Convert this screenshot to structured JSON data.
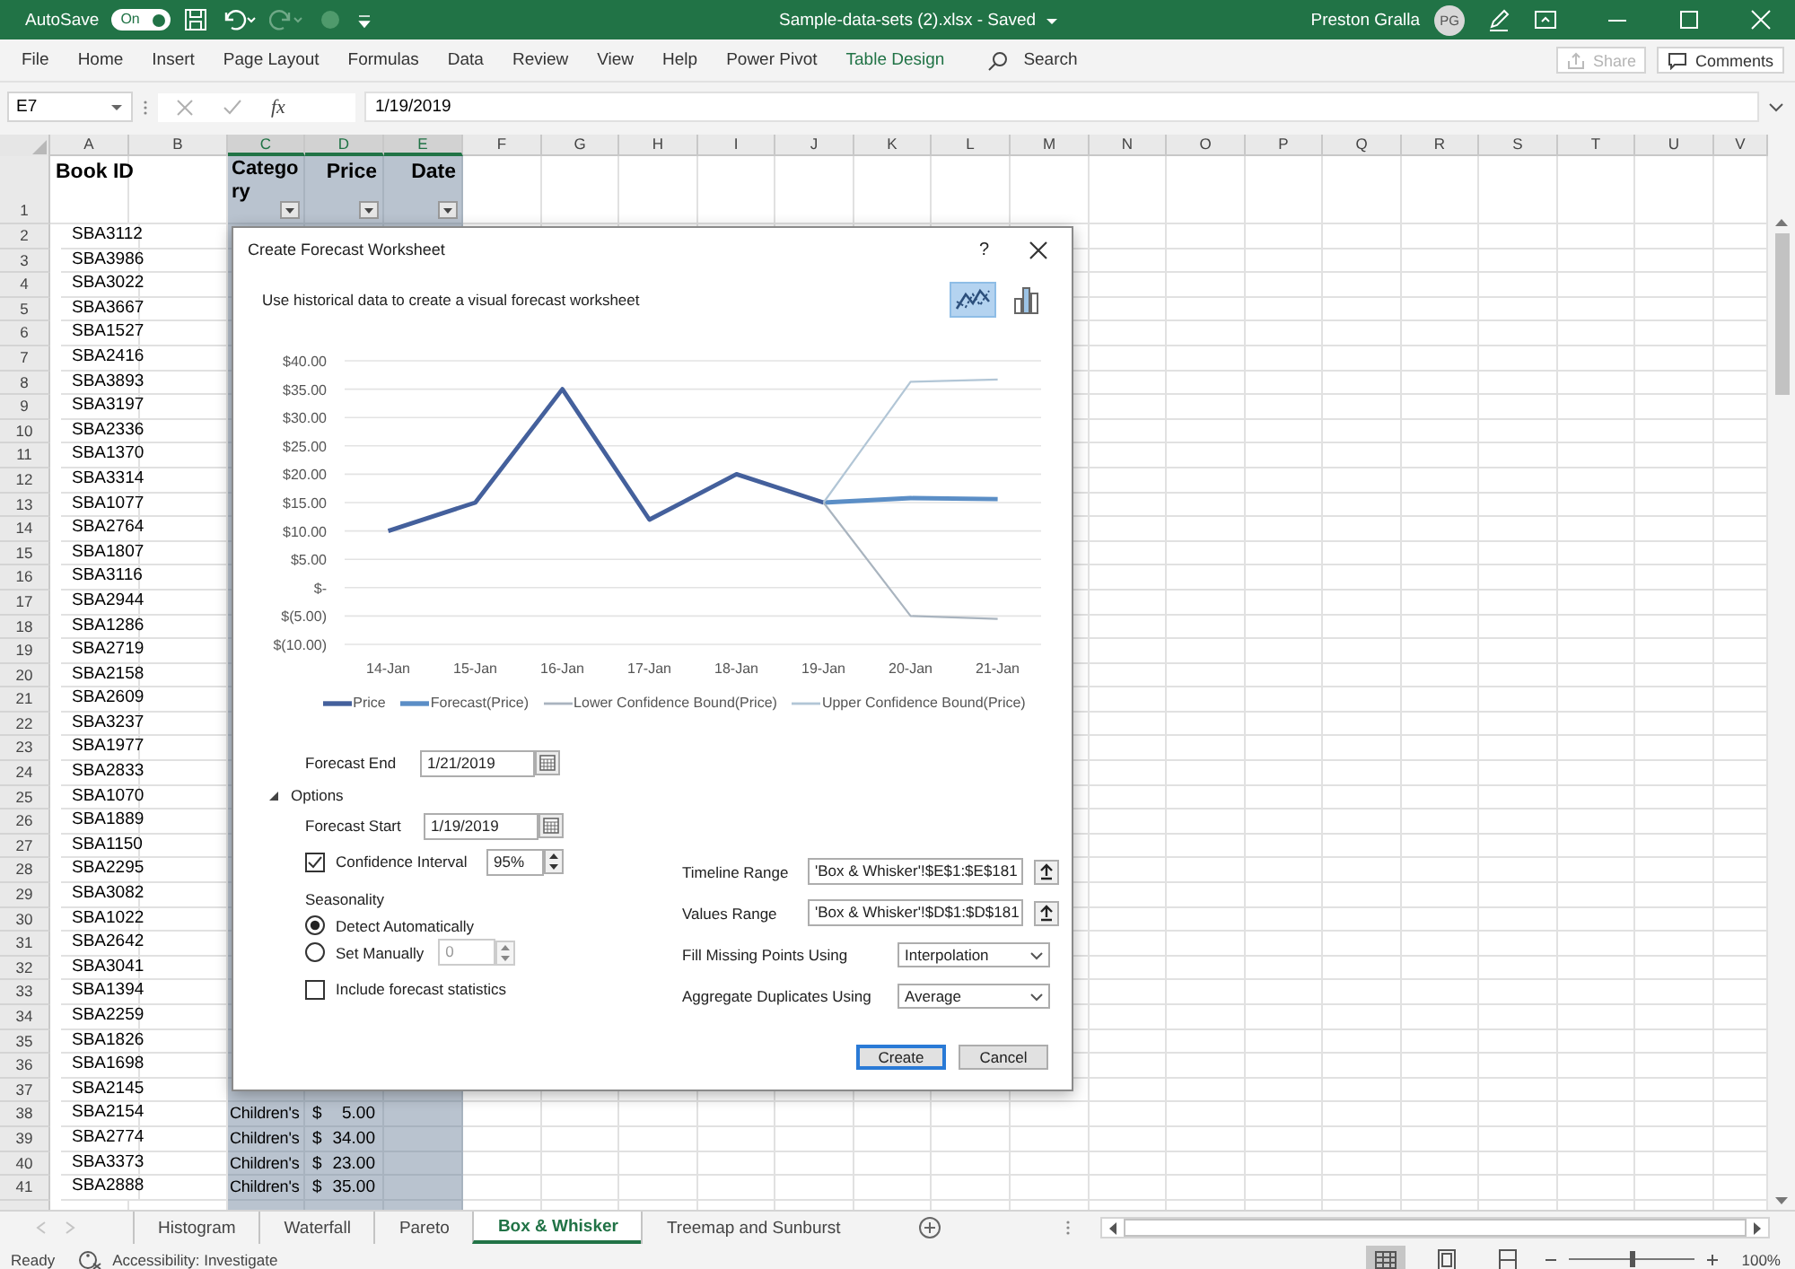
{
  "title_bar": {
    "autosave_label": "AutoSave",
    "autosave": {
      "label": "On",
      "on": true
    },
    "file_title": "Sample-data-sets (2).xlsx - Saved",
    "user_name": "Preston Gralla",
    "user_initials": "PG"
  },
  "ribbon": {
    "tabs": [
      {
        "label": "File",
        "contextual": false
      },
      {
        "label": "Home",
        "contextual": false
      },
      {
        "label": "Insert",
        "contextual": false
      },
      {
        "label": "Page Layout",
        "contextual": false
      },
      {
        "label": "Formulas",
        "contextual": false
      },
      {
        "label": "Data",
        "contextual": false
      },
      {
        "label": "Review",
        "contextual": false
      },
      {
        "label": "View",
        "contextual": false
      },
      {
        "label": "Help",
        "contextual": false
      },
      {
        "label": "Power Pivot",
        "contextual": false
      },
      {
        "label": "Table Design",
        "contextual": true
      }
    ],
    "search": {
      "placeholder": "Search"
    },
    "share": {
      "label": "Share",
      "disabled": true
    },
    "comments": {
      "label": "Comments",
      "disabled": false
    }
  },
  "formula_bar": {
    "name_box": "E7",
    "fx": "fx",
    "formula": "1/19/2019"
  },
  "sheet": {
    "columns": [
      {
        "letter": "A",
        "selected": false
      },
      {
        "letter": "B",
        "selected": false
      },
      {
        "letter": "C",
        "selected": true
      },
      {
        "letter": "D",
        "selected": true
      },
      {
        "letter": "E",
        "selected": true
      },
      {
        "letter": "F",
        "selected": false
      },
      {
        "letter": "G",
        "selected": false
      },
      {
        "letter": "H",
        "selected": false
      },
      {
        "letter": "I",
        "selected": false
      },
      {
        "letter": "J",
        "selected": false
      },
      {
        "letter": "K",
        "selected": false
      },
      {
        "letter": "L",
        "selected": false
      },
      {
        "letter": "M",
        "selected": false
      },
      {
        "letter": "N",
        "selected": false
      },
      {
        "letter": "O",
        "selected": false
      },
      {
        "letter": "P",
        "selected": false
      },
      {
        "letter": "Q",
        "selected": false
      },
      {
        "letter": "R",
        "selected": false
      },
      {
        "letter": "S",
        "selected": false
      },
      {
        "letter": "T",
        "selected": false
      },
      {
        "letter": "U",
        "selected": false
      },
      {
        "letter": "V",
        "selected": false
      }
    ],
    "header_row": {
      "number": "1",
      "book_id": "Book ID",
      "category": "Category",
      "price": "Price",
      "date": "Date",
      "filter_buttons": true
    },
    "rows": [
      {
        "number": "2",
        "book_id": "SBA3112"
      },
      {
        "number": "3",
        "book_id": "SBA3986"
      },
      {
        "number": "4",
        "book_id": "SBA3022"
      },
      {
        "number": "5",
        "book_id": "SBA3667"
      },
      {
        "number": "6",
        "book_id": "SBA1527"
      },
      {
        "number": "7",
        "book_id": "SBA2416"
      },
      {
        "number": "8",
        "book_id": "SBA3893"
      },
      {
        "number": "9",
        "book_id": "SBA3197"
      },
      {
        "number": "10",
        "book_id": "SBA2336"
      },
      {
        "number": "11",
        "book_id": "SBA1370"
      },
      {
        "number": "12",
        "book_id": "SBA3314"
      },
      {
        "number": "13",
        "book_id": "SBA1077"
      },
      {
        "number": "14",
        "book_id": "SBA2764"
      },
      {
        "number": "15",
        "book_id": "SBA1807"
      },
      {
        "number": "16",
        "book_id": "SBA3116"
      },
      {
        "number": "17",
        "book_id": "SBA2944"
      },
      {
        "number": "18",
        "book_id": "SBA1286"
      },
      {
        "number": "19",
        "book_id": "SBA2719"
      },
      {
        "number": "20",
        "book_id": "SBA2158"
      },
      {
        "number": "21",
        "book_id": "SBA2609"
      },
      {
        "number": "22",
        "book_id": "SBA3237"
      },
      {
        "number": "23",
        "book_id": "SBA1977"
      },
      {
        "number": "24",
        "book_id": "SBA2833"
      },
      {
        "number": "25",
        "book_id": "SBA1070"
      },
      {
        "number": "26",
        "book_id": "SBA1889"
      },
      {
        "number": "27",
        "book_id": "SBA1150"
      },
      {
        "number": "28",
        "book_id": "SBA2295"
      },
      {
        "number": "29",
        "book_id": "SBA3082"
      },
      {
        "number": "30",
        "book_id": "SBA1022"
      },
      {
        "number": "31",
        "book_id": "SBA2642"
      },
      {
        "number": "32",
        "book_id": "SBA3041"
      },
      {
        "number": "33",
        "book_id": "SBA1394"
      },
      {
        "number": "34",
        "book_id": "SBA2259"
      },
      {
        "number": "35",
        "book_id": "SBA1826"
      },
      {
        "number": "36",
        "book_id": "SBA1698"
      },
      {
        "number": "37",
        "book_id": "SBA2145"
      },
      {
        "number": "38",
        "book_id": "SBA2154",
        "category": "Children's",
        "currency": "$",
        "price": "5.00"
      },
      {
        "number": "39",
        "book_id": "SBA2774",
        "category": "Children's",
        "currency": "$",
        "price": "34.00"
      },
      {
        "number": "40",
        "book_id": "SBA3373",
        "category": "Children's",
        "currency": "$",
        "price": "23.00"
      },
      {
        "number": "41",
        "book_id": "SBA2888",
        "category": "Children's",
        "currency": "$",
        "price": "35.00"
      }
    ]
  },
  "dialog": {
    "title": "Create Forecast Worksheet",
    "help": "?",
    "description": "Use historical data to create a visual forecast worksheet",
    "chart_types": [
      {
        "kind": "line",
        "selected": true
      },
      {
        "kind": "column",
        "selected": false
      }
    ],
    "chart_data": {
      "type": "line",
      "categories": [
        "14-Jan",
        "15-Jan",
        "16-Jan",
        "17-Jan",
        "18-Jan",
        "19-Jan",
        "20-Jan",
        "21-Jan"
      ],
      "series": [
        {
          "name": "Price",
          "color": "#44609c",
          "values": [
            10,
            15,
            35,
            12,
            20,
            15,
            null,
            null
          ]
        },
        {
          "name": "Forecast(Price)",
          "color": "#5b8ec6",
          "values": [
            null,
            null,
            null,
            null,
            null,
            15,
            15.8,
            15.6
          ]
        },
        {
          "name": "Lower Confidence Bound(Price)",
          "color": "#a9b4bf",
          "values": [
            null,
            null,
            null,
            null,
            null,
            15,
            -5,
            -5.5
          ]
        },
        {
          "name": "Upper Confidence Bound(Price)",
          "color": "#b2c6d6",
          "values": [
            null,
            null,
            null,
            null,
            null,
            15,
            36.3,
            36.7
          ]
        }
      ],
      "ylim": [
        -10,
        40
      ],
      "grid": true,
      "legend": "bottom",
      "yticks": [
        {
          "value": -10,
          "label": "$(10.00)"
        },
        {
          "value": -5,
          "label": "$(5.00)"
        },
        {
          "value": 0,
          "label": "$-"
        },
        {
          "value": 5,
          "label": "$5.00"
        },
        {
          "value": 10,
          "label": "$10.00"
        },
        {
          "value": 15,
          "label": "$15.00"
        },
        {
          "value": 20,
          "label": "$20.00"
        },
        {
          "value": 25,
          "label": "$25.00"
        },
        {
          "value": 30,
          "label": "$30.00"
        },
        {
          "value": 35,
          "label": "$35.00"
        },
        {
          "value": 40,
          "label": "$40.00"
        }
      ]
    },
    "forecast_end": {
      "label": "Forecast End",
      "value": "1/21/2019"
    },
    "options": {
      "label": "Options",
      "expanded": true
    },
    "forecast_start": {
      "label": "Forecast Start",
      "value": "1/19/2019"
    },
    "confidence": {
      "label": "Confidence Interval",
      "checked": true,
      "value": "95%"
    },
    "seasonality": {
      "label": "Seasonality",
      "choices": [
        {
          "label": "Detect Automatically",
          "selected": true
        },
        {
          "label": "Set Manually",
          "selected": false
        }
      ],
      "manual_value": "0",
      "manual_disabled": true
    },
    "include_stats": {
      "label": "Include forecast statistics",
      "checked": false
    },
    "timeline_range": {
      "label": "Timeline Range",
      "value": "'Box & Whisker'!$E$1:$E$181"
    },
    "values_range": {
      "label": "Values Range",
      "value": "'Box & Whisker'!$D$1:$D$181"
    },
    "fill_missing": {
      "label": "Fill Missing Points Using",
      "value": "Interpolation"
    },
    "aggregate": {
      "label": "Aggregate Duplicates Using",
      "value": "Average"
    },
    "buttons": [
      {
        "label": "Create",
        "default": true
      },
      {
        "label": "Cancel",
        "default": false
      }
    ]
  },
  "sheet_tabs": [
    {
      "label": "Histogram",
      "selected": false
    },
    {
      "label": "Waterfall",
      "selected": false
    },
    {
      "label": "Pareto",
      "selected": false
    },
    {
      "label": "Box & Whisker",
      "selected": true
    },
    {
      "label": "Treemap and Sunburst",
      "selected": false
    }
  ],
  "status_bar": {
    "ready": "Ready",
    "accessibility": "Accessibility: Investigate",
    "views": [
      {
        "kind": "normal",
        "selected": true
      },
      {
        "kind": "page_layout",
        "selected": false
      },
      {
        "kind": "page_break",
        "selected": false
      }
    ],
    "zoom": {
      "level": 0.5,
      "label": "100%"
    }
  }
}
